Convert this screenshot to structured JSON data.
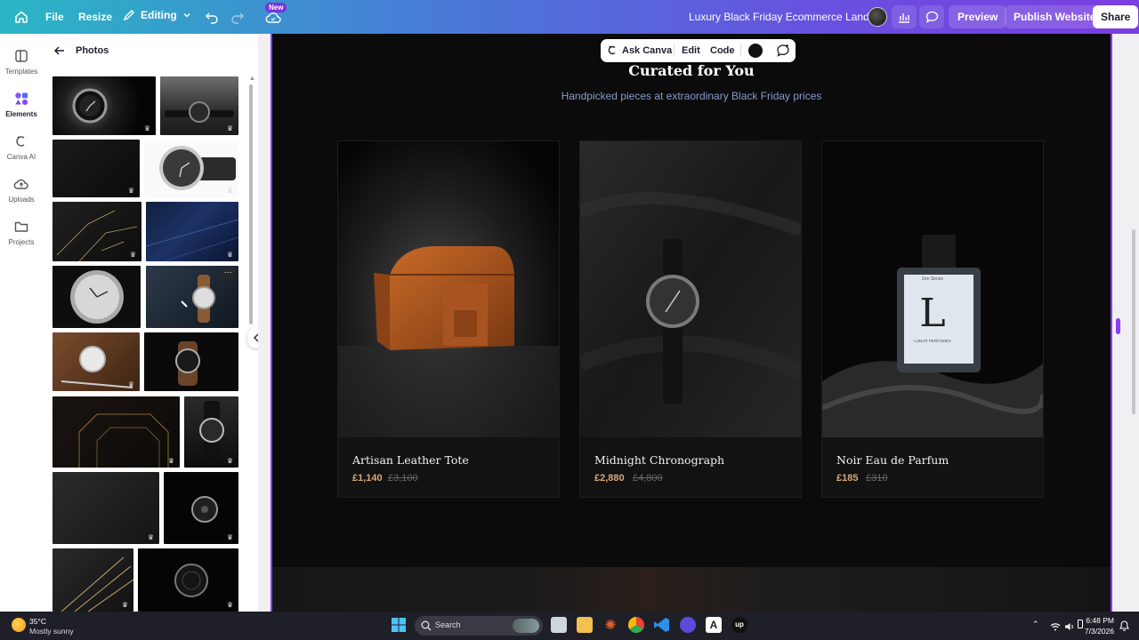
{
  "topbar": {
    "file": "File",
    "resize": "Resize",
    "editing": "Editing",
    "new_badge": "New",
    "title": "Luxury Black Friday Ecommerce Landing",
    "preview": "Preview",
    "publish": "Publish Website",
    "share": "Share"
  },
  "rail": {
    "items": [
      {
        "label": "Templates",
        "icon": "templates-icon"
      },
      {
        "label": "Elements",
        "icon": "elements-icon"
      },
      {
        "label": "Canva AI",
        "icon": "canva-ai-icon"
      },
      {
        "label": "Uploads",
        "icon": "uploads-icon"
      },
      {
        "label": "Projects",
        "icon": "projects-icon"
      }
    ]
  },
  "panel": {
    "title": "Photos",
    "more": "···"
  },
  "float_toolbar": {
    "ask": "Ask Canva",
    "edit": "Edit",
    "code": "Code"
  },
  "hero": {
    "title": "Curated for You",
    "subtitle": "Handpicked pieces at extraordinary Black Friday prices"
  },
  "products": [
    {
      "name": "Artisan Leather Tote",
      "price": "£1,140",
      "old_price": "£3,100"
    },
    {
      "name": "Midnight Chronograph",
      "price": "£2,880",
      "old_price": "£4,800"
    },
    {
      "name": "Noir Eau de Parfum",
      "price": "£185",
      "old_price": "£310"
    }
  ],
  "perfume_label": {
    "brand": "Zen Sense",
    "letter": "L",
    "name": "LUNAR PERFUMES"
  },
  "taskbar": {
    "temp": "35°C",
    "condition": "Mostly sunny",
    "search": "Search",
    "time": "6:48 PM",
    "date": "7/3/2026"
  },
  "colors": {
    "accent": "#8b3dff",
    "page_bg": "#0b0b0b",
    "price": "#d7a97a"
  }
}
